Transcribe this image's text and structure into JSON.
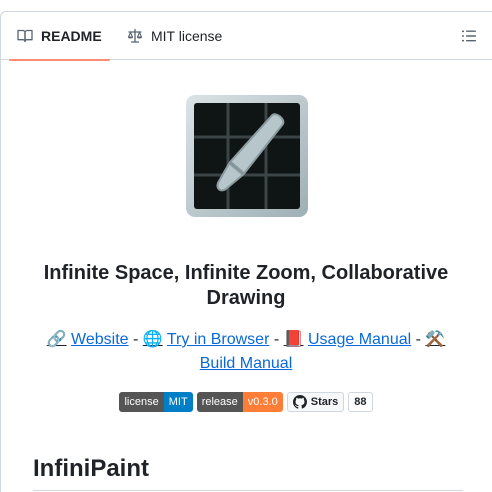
{
  "tabs": {
    "readme": "README",
    "license": "MIT license"
  },
  "icons": {
    "readme": "book-icon",
    "license": "scale-icon",
    "toc": "list-icon",
    "logo": "paintbrush-logo",
    "website": "link-emoji",
    "browser": "globe-emoji",
    "manual": "book-emoji",
    "build": "hammer-pick-emoji",
    "github": "github-icon"
  },
  "colors": {
    "link": "#0969da",
    "tab_underline": "#fd8c73",
    "badge_grey": "#555555",
    "badge_blue": "#007ec6",
    "badge_orange": "#fe7d37"
  },
  "readme": {
    "title": "Infinite Space, Infinite Zoom, Collaborative Drawing",
    "links": {
      "website_emoji": "🔗",
      "website": "Website",
      "sep": "-",
      "browser_emoji": "🌐",
      "browser": "Try in Browser",
      "manual_emoji": "📕",
      "manual": "Usage Manual",
      "build_emoji": "⚒️",
      "build": "Build Manual"
    },
    "badges": {
      "license_label": "license",
      "license_value": "MIT",
      "release_label": "release",
      "release_value": "v0.3.0",
      "stars_label": "Stars",
      "stars_count": "88"
    },
    "heading": "InfiniPaint"
  }
}
